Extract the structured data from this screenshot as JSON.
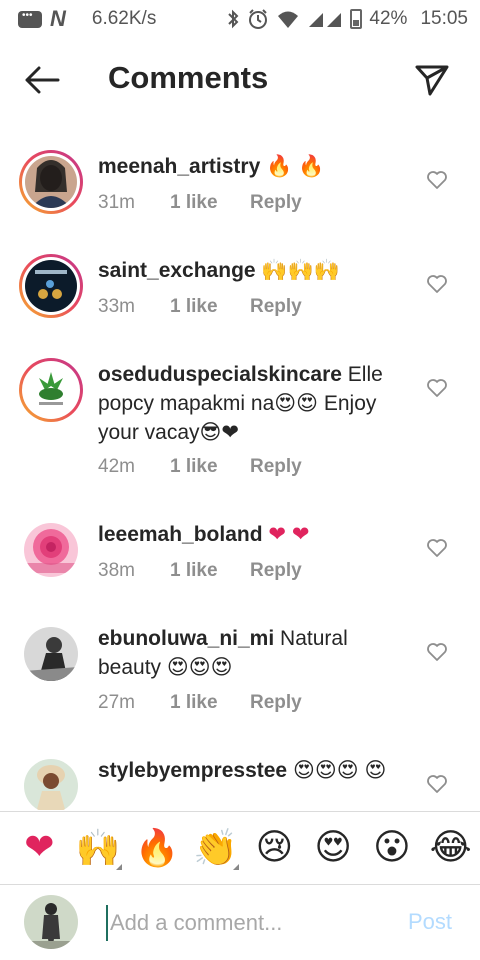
{
  "status_bar": {
    "net_speed": "6.62K/s",
    "battery_percent": "42%",
    "time": "15:05",
    "icons": [
      "message-icon",
      "n-app-icon",
      "bluetooth-icon",
      "alarm-icon",
      "wifi-icon",
      "signal-icon",
      "battery-icon"
    ]
  },
  "header": {
    "title": "Comments",
    "back_icon": "back-arrow-icon",
    "share_icon": "send-icon"
  },
  "comments": [
    {
      "username": "meenah_artistry",
      "text": " 🔥 🔥",
      "time": "31m",
      "likes": "1 like",
      "reply": "Reply"
    },
    {
      "username": "saint_exchange",
      "text": " 🙌🙌🙌",
      "time": "33m",
      "likes": "1 like",
      "reply": "Reply"
    },
    {
      "username": "oseduduspecialskincare",
      "text": " Elle popcy mapakmi na😍😍 Enjoy your vacay😎❤",
      "time": "42m",
      "likes": "1 like",
      "reply": "Reply"
    },
    {
      "username": "leeemah_boland",
      "text": " ❤ ❤",
      "time": "38m",
      "likes": "1 like",
      "reply": "Reply"
    },
    {
      "username": "ebunoluwa_ni_mi",
      "text": " Natural beauty 😍😍😍",
      "time": "27m",
      "likes": "1 like",
      "reply": "Reply"
    },
    {
      "username": "stylebyempresstee",
      "text": " 😍😍😍 😍",
      "time": "",
      "likes": "",
      "reply": ""
    }
  ],
  "emoji_bar": [
    "❤",
    "🙌",
    "🔥",
    "👏",
    "😢",
    "😍",
    "😮",
    "😂"
  ],
  "composer": {
    "placeholder": "Add a comment...",
    "post_label": "Post"
  },
  "colors": {
    "text": "#262626",
    "meta": "#8e8e8e",
    "post_disabled": "#b3dbff",
    "story_ring_start": "#f6b12e",
    "story_ring_end": "#c1358f",
    "heart": "#e0245e"
  }
}
